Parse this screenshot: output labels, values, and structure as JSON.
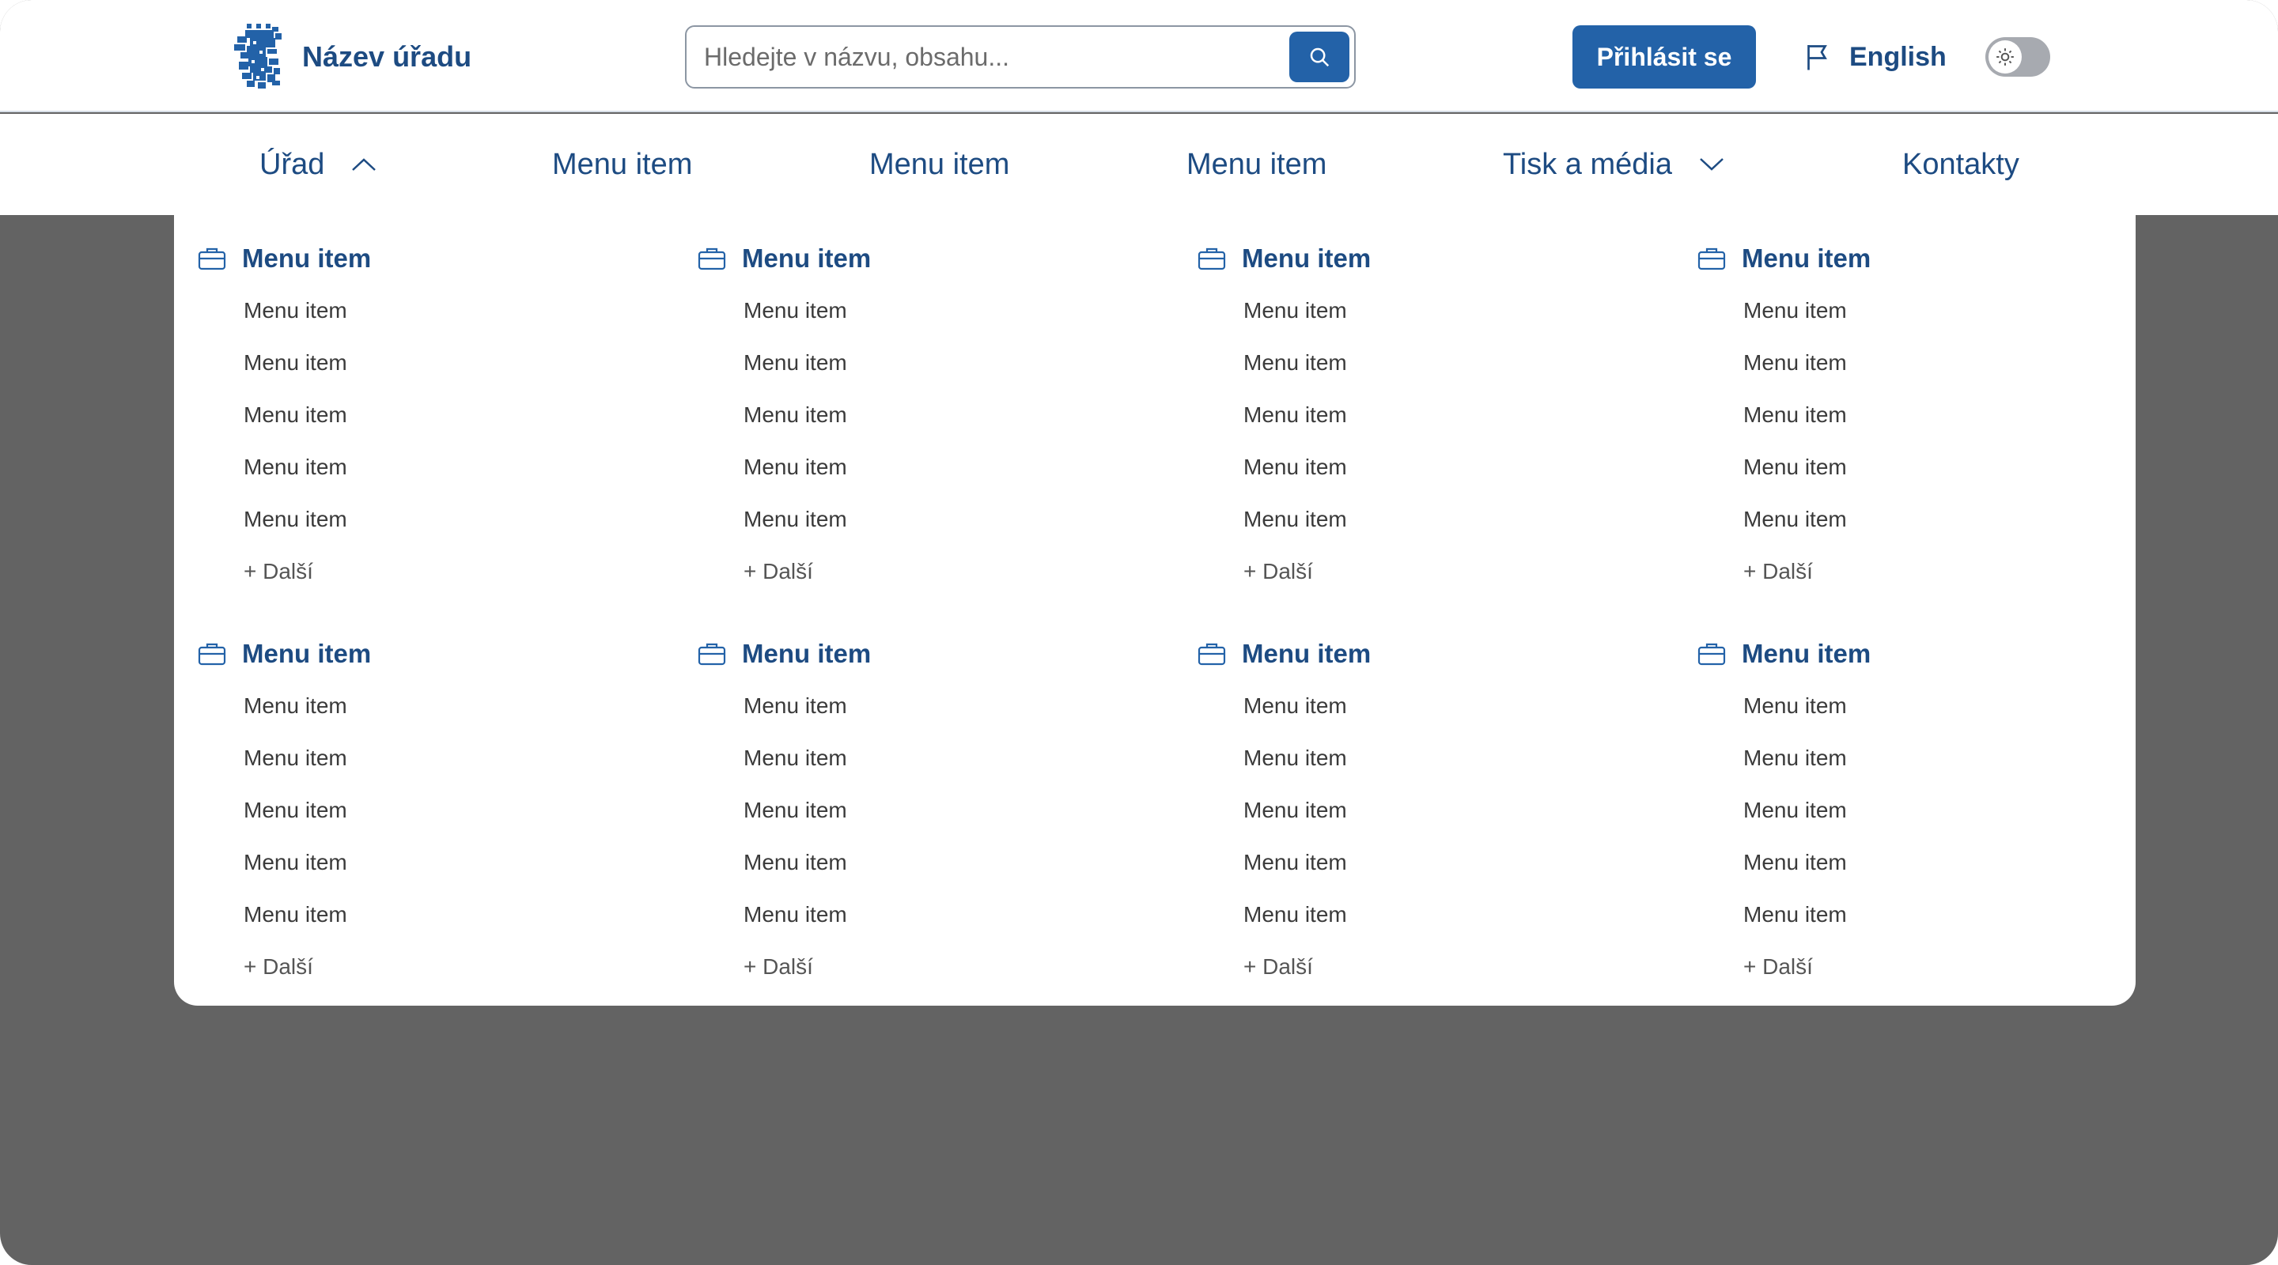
{
  "header": {
    "site_name": "Název úřadu",
    "search_placeholder": "Hledejte v názvu, obsahu...",
    "login_label": "Přihlásit se",
    "language_label": "English",
    "icons": [
      "lion-logo-icon",
      "search-icon",
      "flag-icon",
      "sun-icon"
    ],
    "theme_toggle": "off"
  },
  "colors": {
    "brand": "#1d4b82",
    "button": "#2362a8",
    "overlay": "#636363"
  },
  "nav": {
    "items": [
      {
        "label": "Úřad",
        "chevron": "up"
      },
      {
        "label": "Menu item"
      },
      {
        "label": "Menu item"
      },
      {
        "label": "Menu item"
      },
      {
        "label": "Tisk a média",
        "chevron": "down"
      },
      {
        "label": "Kontakty"
      }
    ]
  },
  "mega_menu": {
    "groups": [
      {
        "title": "Menu item",
        "items": [
          "Menu item",
          "Menu item",
          "Menu item",
          "Menu item",
          "Menu item"
        ],
        "more": "+ Další"
      },
      {
        "title": "Menu item",
        "items": [
          "Menu item",
          "Menu item",
          "Menu item",
          "Menu item",
          "Menu item"
        ],
        "more": "+ Další"
      },
      {
        "title": "Menu item",
        "items": [
          "Menu item",
          "Menu item",
          "Menu item",
          "Menu item",
          "Menu item"
        ],
        "more": "+ Další"
      },
      {
        "title": "Menu item",
        "items": [
          "Menu item",
          "Menu item",
          "Menu item",
          "Menu item",
          "Menu item"
        ],
        "more": "+ Další"
      },
      {
        "title": "Menu item",
        "items": [
          "Menu item",
          "Menu item",
          "Menu item",
          "Menu item",
          "Menu item"
        ],
        "more": "+ Další"
      },
      {
        "title": "Menu item",
        "items": [
          "Menu item",
          "Menu item",
          "Menu item",
          "Menu item",
          "Menu item"
        ],
        "more": "+ Další"
      },
      {
        "title": "Menu item",
        "items": [
          "Menu item",
          "Menu item",
          "Menu item",
          "Menu item",
          "Menu item"
        ],
        "more": "+ Další"
      },
      {
        "title": "Menu item",
        "items": [
          "Menu item",
          "Menu item",
          "Menu item",
          "Menu item",
          "Menu item"
        ],
        "more": "+ Další"
      }
    ]
  }
}
